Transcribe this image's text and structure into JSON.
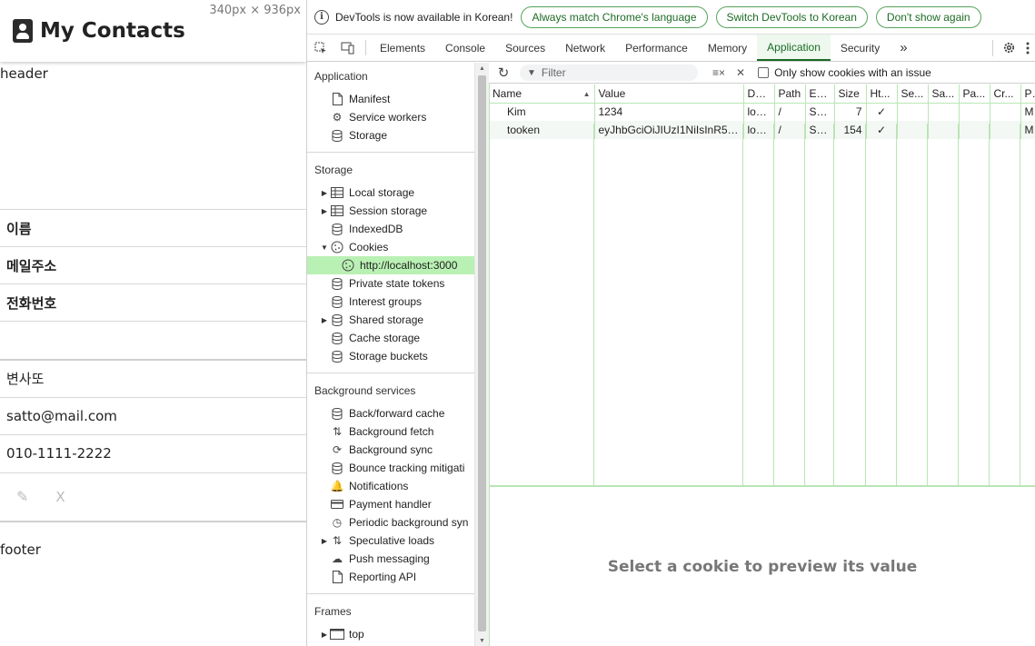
{
  "page": {
    "dimension_label": "340px × 936px",
    "title": "My Contacts",
    "header_text": "header",
    "labels": [
      "이름",
      "메일주소",
      "전화번호"
    ],
    "contact": {
      "name": "변사또",
      "email": "satto@mail.com",
      "phone": "010-1111-2222"
    },
    "actions": {
      "edit_glyph": "✎",
      "delete_label": "X"
    },
    "footer_text": "footer"
  },
  "infobar": {
    "message": "DevTools is now available in Korean!",
    "buttons": [
      "Always match Chrome's language",
      "Switch DevTools to Korean",
      "Don't show again"
    ]
  },
  "tabs": {
    "items": [
      "Elements",
      "Console",
      "Sources",
      "Network",
      "Performance",
      "Memory",
      "Application",
      "Security"
    ],
    "active": "Application",
    "more_glyph": "»"
  },
  "sidebar": {
    "application": {
      "heading": "Application",
      "items": [
        {
          "label": "Manifest",
          "icon": "file-icon"
        },
        {
          "label": "Service workers",
          "icon": "gears-icon"
        },
        {
          "label": "Storage",
          "icon": "database-icon"
        }
      ]
    },
    "storage": {
      "heading": "Storage",
      "items": [
        {
          "label": "Local storage",
          "icon": "table-icon",
          "arrow": "▶"
        },
        {
          "label": "Session storage",
          "icon": "table-icon",
          "arrow": "▶"
        },
        {
          "label": "IndexedDB",
          "icon": "database-icon",
          "arrow": ""
        },
        {
          "label": "Cookies",
          "icon": "cookie-icon",
          "arrow": "▼"
        },
        {
          "label": "http://localhost:3000",
          "icon": "cookie-icon",
          "arrow": "",
          "child": true,
          "selected": true
        },
        {
          "label": "Private state tokens",
          "icon": "database-icon",
          "arrow": ""
        },
        {
          "label": "Interest groups",
          "icon": "database-icon",
          "arrow": ""
        },
        {
          "label": "Shared storage",
          "icon": "database-icon",
          "arrow": "▶"
        },
        {
          "label": "Cache storage",
          "icon": "database-icon",
          "arrow": ""
        },
        {
          "label": "Storage buckets",
          "icon": "database-icon",
          "arrow": ""
        }
      ]
    },
    "background": {
      "heading": "Background services",
      "items": [
        {
          "label": "Back/forward cache",
          "icon": "database-icon",
          "arrow": ""
        },
        {
          "label": "Background fetch",
          "icon": "updown-icon",
          "arrow": ""
        },
        {
          "label": "Background sync",
          "icon": "sync-icon",
          "arrow": ""
        },
        {
          "label": "Bounce tracking mitigati",
          "icon": "database-icon",
          "arrow": ""
        },
        {
          "label": "Notifications",
          "icon": "bell-icon",
          "arrow": ""
        },
        {
          "label": "Payment handler",
          "icon": "card-icon",
          "arrow": ""
        },
        {
          "label": "Periodic background syn",
          "icon": "clock-icon",
          "arrow": ""
        },
        {
          "label": "Speculative loads",
          "icon": "updown-icon",
          "arrow": "▶"
        },
        {
          "label": "Push messaging",
          "icon": "cloud-icon",
          "arrow": ""
        },
        {
          "label": "Reporting API",
          "icon": "file-icon",
          "arrow": ""
        }
      ]
    },
    "frames": {
      "heading": "Frames",
      "items": [
        {
          "label": "top",
          "icon": "frame-icon",
          "arrow": "▶"
        }
      ]
    }
  },
  "toolbar": {
    "filter_placeholder": "Filter",
    "checkbox_label": "Only show cookies with an issue"
  },
  "cookies": {
    "columns": [
      "Name",
      "Value",
      "Do...",
      "Path",
      "Ex...",
      "Size",
      "Ht...",
      "Se...",
      "Sa...",
      "Pa...",
      "Cr...",
      "Pr"
    ],
    "sort_indicator": "▲",
    "rows": [
      [
        "Kim",
        "1234",
        "loc...",
        "/",
        "Se...",
        "7",
        "✓",
        "",
        "",
        "",
        "",
        "M"
      ],
      [
        "tooken",
        "eyJhbGciOiJIUzI1NiIsInR5c...",
        "loc...",
        "/",
        "Se...",
        "154",
        "✓",
        "",
        "",
        "",
        "",
        "M"
      ]
    ]
  },
  "preview": {
    "message": "Select a cookie to preview its value"
  },
  "colors": {
    "accent": "#1a6a25",
    "selected_row": "#b9f0b3",
    "grid": "#b9e6b4"
  }
}
